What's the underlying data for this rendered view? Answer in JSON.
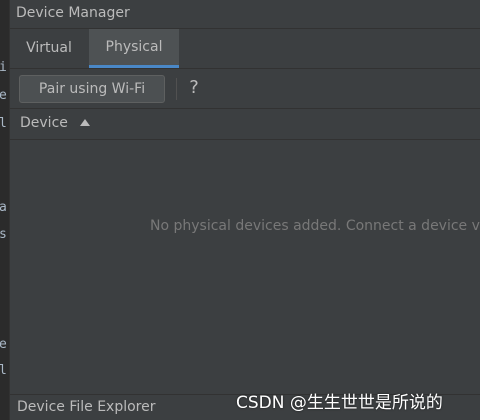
{
  "window": {
    "title": "Device Manager"
  },
  "tabs": [
    {
      "label": "Virtual",
      "selected": false
    },
    {
      "label": "Physical",
      "selected": true
    }
  ],
  "toolbar": {
    "pair_button_label": "Pair using Wi-Fi",
    "help_label": "?"
  },
  "table": {
    "columns": [
      {
        "label": "Device",
        "sort": "ascending",
        "sort_icon": "sort-ascending-icon"
      }
    ],
    "empty_message": "No physical devices added. Connect a device via USB cable."
  },
  "bottom_tool_window": {
    "label": "Device File Explorer"
  },
  "gutter_fragments": [
    "i",
    "e",
    "l",
    "a",
    "s",
    "e",
    "l"
  ],
  "watermark": "CSDN @生生世世是所说的",
  "colors": {
    "background": "#3c3f41",
    "gutter": "#2b2b2b",
    "text": "#bbbbbb",
    "muted_text": "#787878",
    "selected_tab_underline": "#4a88c7",
    "button_bg": "#4c5052"
  }
}
